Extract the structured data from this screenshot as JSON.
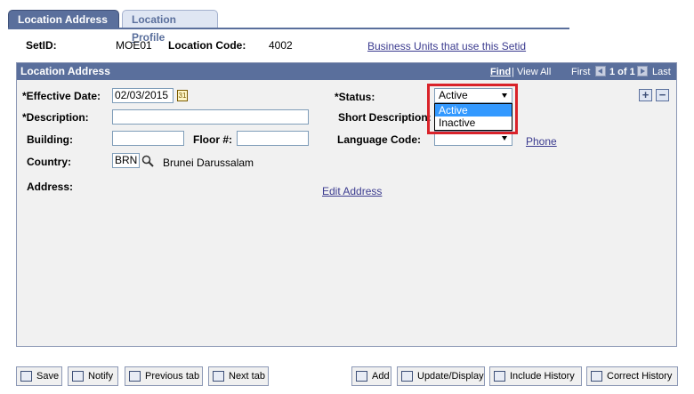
{
  "tabs": [
    {
      "label": "Location Address",
      "active": true
    },
    {
      "label": "Location ",
      "label_ul": "P",
      "label_rest": "rofile",
      "active": false
    }
  ],
  "header": {
    "setid_label": "SetID:",
    "setid_value": "MOE01",
    "location_code_label": "Location Code:",
    "location_code_value": "4002",
    "bu_link": "Business Units that use this Setid"
  },
  "panel": {
    "title": "Location Address",
    "nav": {
      "find": "Find",
      "separator": "|",
      "view_all": "View All",
      "first": "First",
      "count": "1 of 1",
      "last": "Last"
    }
  },
  "form": {
    "effective_date_label": "*Effective Date:",
    "effective_date_value": "02/03/2015",
    "calendar_glyph": "31",
    "status_label": "*Status:",
    "status_value": "Active",
    "status_options": [
      "Active",
      "Inactive"
    ],
    "description_label": "*Description:",
    "description_value": "",
    "short_description_label": "Short Description:",
    "building_label": "Building:",
    "building_value": "",
    "floor_label": "Floor #:",
    "floor_value": "",
    "language_code_label": "Language Code:",
    "language_code_value": "",
    "phone_link": "Phone",
    "country_label": "Country:",
    "country_code": "BRN",
    "country_name": "Brunei Darussalam",
    "address_label": "Address:",
    "edit_address_link": "Edit Address"
  },
  "toolbar": {
    "save": "Save",
    "notify": "Notify",
    "previous_tab": "Previous tab",
    "next_tab": "Next tab",
    "add": "Add",
    "update_display": "Update/Display",
    "include_history": "Include History",
    "correct_history": "Correct History"
  },
  "colors": {
    "accent": "#5a6f9c",
    "link": "#3b3b8f",
    "highlight": "#d9232a",
    "selected_option": "#3399ff"
  }
}
